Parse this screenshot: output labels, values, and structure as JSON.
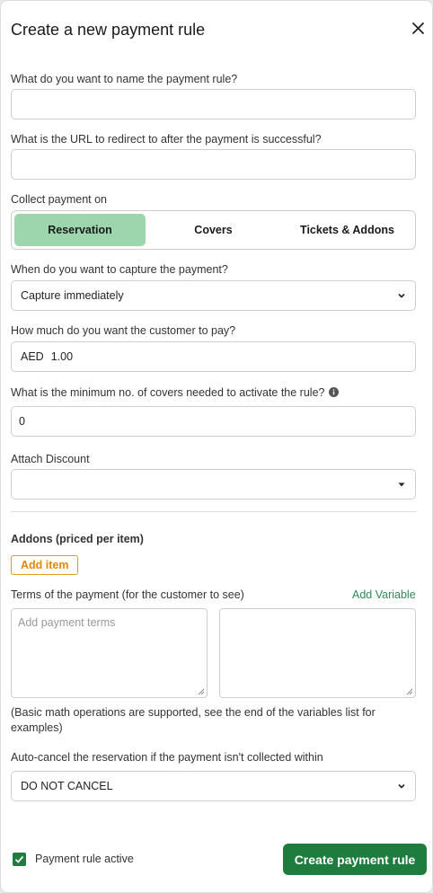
{
  "header": {
    "title": "Create a new payment rule"
  },
  "fields": {
    "name": {
      "label": "What do you want to name the payment rule?",
      "value": ""
    },
    "redirect": {
      "label": "What is the URL to redirect to after the payment is successful?",
      "value": ""
    },
    "collect": {
      "label": "Collect payment on",
      "options": [
        "Reservation",
        "Covers",
        "Tickets & Addons"
      ],
      "selected": "Reservation"
    },
    "capture": {
      "label": "When do you want to capture the payment?",
      "value": "Capture immediately"
    },
    "amount": {
      "label": "How much do you want the customer to pay?",
      "currency": "AED",
      "value": "1.00"
    },
    "min_covers": {
      "label": "What is the minimum no. of covers needed to activate the rule?",
      "value": "0"
    },
    "discount": {
      "label": "Attach Discount",
      "value": ""
    }
  },
  "addons": {
    "title": "Addons (priced per item)",
    "add_label": "Add item"
  },
  "terms": {
    "label": "Terms of the payment (for the customer to see)",
    "add_variable": "Add Variable",
    "placeholder": "Add payment terms",
    "note": "(Basic math operations are supported, see the end of the variables list for examples)"
  },
  "auto_cancel": {
    "label": "Auto-cancel the reservation if the payment isn't collected within",
    "value": "DO NOT CANCEL"
  },
  "footer": {
    "active_label": "Payment rule active",
    "active_checked": true,
    "submit_label": "Create payment rule"
  },
  "colors": {
    "primary": "#1e7d3e",
    "segment_active": "#9dd5ad",
    "add_item": "#e08a00",
    "link": "#2e8b57"
  },
  "icons": {
    "close": "close-icon",
    "caret": "chevron-down-icon",
    "info": "info-icon",
    "check": "check-icon"
  }
}
